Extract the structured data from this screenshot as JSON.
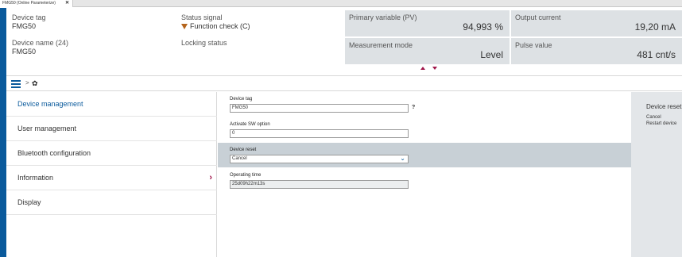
{
  "tab": {
    "title": "FMG50 (Online Parameterize)",
    "close": "✕"
  },
  "header": {
    "device_tag_label": "Device tag",
    "device_tag_value": "FMG50",
    "status_signal_label": "Status signal",
    "status_signal_value": "Function check (C)",
    "device_name_label": "Device name (24)",
    "device_name_value": "FMG50",
    "locking_status_label": "Locking status",
    "panels": {
      "primary_variable": {
        "label": "Primary variable (PV)",
        "value": "94,993 %"
      },
      "output_current": {
        "label": "Output current",
        "value": "19,20 mA"
      },
      "measurement_mode": {
        "label": "Measurement mode",
        "value": "Level"
      },
      "pulse_value": {
        "label": "Pulse value",
        "value": "481 cnt/s"
      }
    }
  },
  "breadcrumb": {
    "separator": ">"
  },
  "menu": {
    "items": [
      {
        "label": "Device management"
      },
      {
        "label": "User management"
      },
      {
        "label": "Bluetooth configuration"
      },
      {
        "label": "Information"
      },
      {
        "label": "Display"
      }
    ]
  },
  "form": {
    "device_tag": {
      "label": "Device tag",
      "value": "FMG50",
      "help": "?"
    },
    "activate_sw_option": {
      "label": "Activate SW option",
      "value": "0"
    },
    "device_reset": {
      "label": "Device reset",
      "value": "Cancel"
    },
    "operating_time": {
      "label": "Operating time",
      "value": "25d09h22m13s"
    }
  },
  "side_panel": {
    "title": "Device reset",
    "options": [
      "Cancel",
      "Restart device"
    ]
  },
  "colors": {
    "accent_blue": "#0a5a9c",
    "brand_magenta": "#a0154a",
    "warning_orange": "#b5651d",
    "panel_grey": "#dde1e4"
  }
}
